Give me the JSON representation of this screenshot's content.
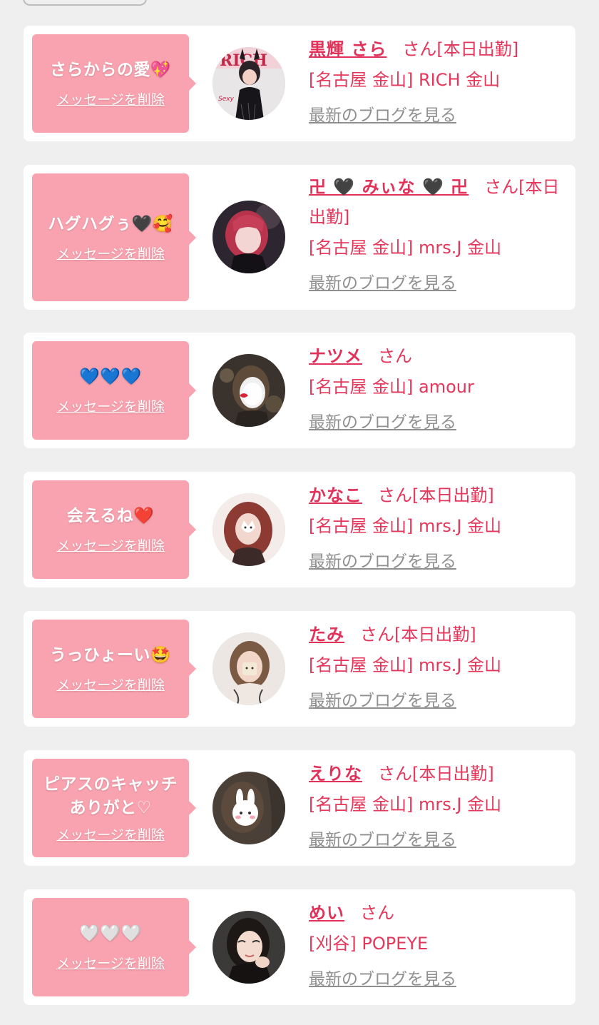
{
  "messages": [
    {
      "text": "さらからの愛💖",
      "delete_label": "メッセージを削除",
      "name": "黒輝 さら",
      "suffix": "さん[本日出勤]",
      "shop": "[名古屋 金山] RICH 金山",
      "blog_label": "最新のブログを見る"
    },
    {
      "text": "ハグハグぅ🖤🥰",
      "delete_label": "メッセージを削除",
      "name": "卍 🖤 みぃな 🖤 卍",
      "suffix": "さん[本日出勤]",
      "shop": "[名古屋 金山] mrs.J 金山",
      "blog_label": "最新のブログを見る"
    },
    {
      "text": "💙💙💙",
      "delete_label": "メッセージを削除",
      "name": "ナツメ",
      "suffix": "さん",
      "shop": "[名古屋 金山] amour",
      "blog_label": "最新のブログを見る"
    },
    {
      "text": "会えるね❤️",
      "delete_label": "メッセージを削除",
      "name": "かなこ",
      "suffix": "さん[本日出勤]",
      "shop": "[名古屋 金山] mrs.J 金山",
      "blog_label": "最新のブログを見る"
    },
    {
      "text": "うっひょーい🤩",
      "delete_label": "メッセージを削除",
      "name": "たみ",
      "suffix": "さん[本日出勤]",
      "shop": "[名古屋 金山] mrs.J 金山",
      "blog_label": "最新のブログを見る"
    },
    {
      "text": "ピアスのキャッチありがと♡",
      "delete_label": "メッセージを削除",
      "name": "えりな",
      "suffix": "さん[本日出勤]",
      "shop": "[名古屋 金山] mrs.J 金山",
      "blog_label": "最新のブログを見る"
    },
    {
      "text": "🤍🤍🤍",
      "delete_label": "メッセージを削除",
      "name": "めい",
      "suffix": "さん",
      "shop": "[刈谷] POPEYE",
      "blog_label": "最新のブログを見る"
    }
  ]
}
